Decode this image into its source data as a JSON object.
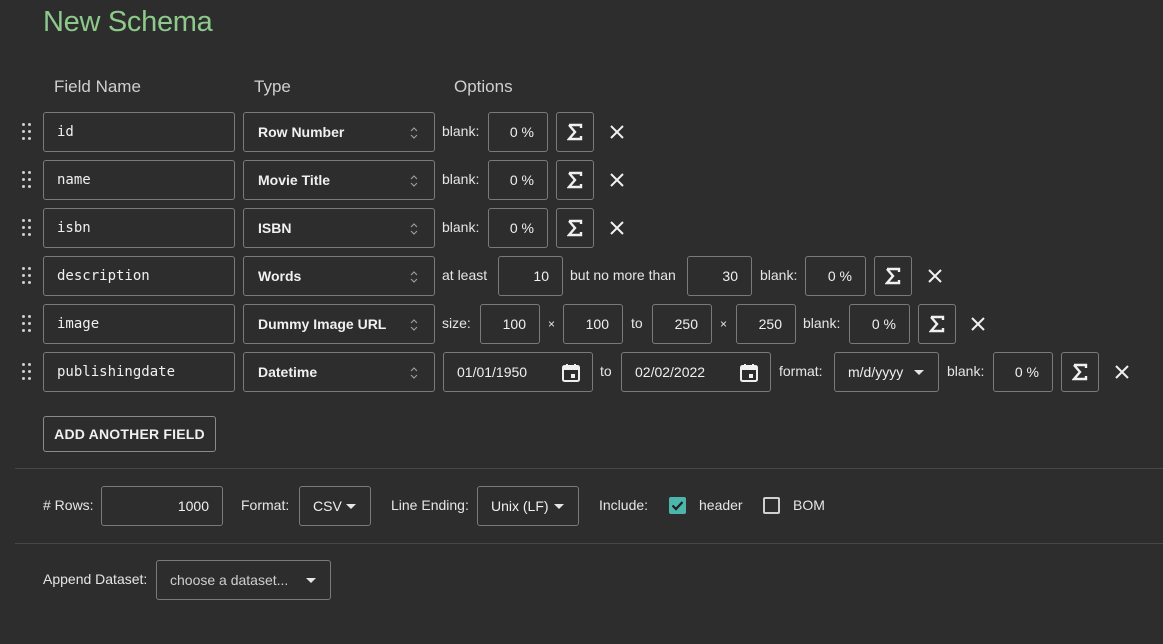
{
  "title": "New Schema",
  "columns": {
    "field_name": "Field Name",
    "type": "Type",
    "options": "Options"
  },
  "fields": [
    {
      "name": "id",
      "type": "Row Number",
      "blank_label": "blank:",
      "blank": "0 %"
    },
    {
      "name": "name",
      "type": "Movie Title",
      "blank_label": "blank:",
      "blank": "0 %"
    },
    {
      "name": "isbn",
      "type": "ISBN",
      "blank_label": "blank:",
      "blank": "0 %"
    },
    {
      "name": "description",
      "type": "Words",
      "atleast_label": "at least",
      "atleast": "10",
      "nomore_label": "but no more than",
      "nomore": "30",
      "blank_label": "blank:",
      "blank": "0 %"
    },
    {
      "name": "image",
      "type": "Dummy Image URL",
      "size_label": "size:",
      "w1": "100",
      "times": "×",
      "h1": "100",
      "to_label": "to",
      "w2": "250",
      "h2": "250",
      "blank_label": "blank:",
      "blank": "0 %"
    },
    {
      "name": "publishingdate",
      "type": "Datetime",
      "from": "01/01/1950",
      "to_label": "to",
      "to": "02/02/2022",
      "format_label": "format:",
      "format": "m/d/yyyy",
      "blank_label": "blank:",
      "blank": "0 %"
    }
  ],
  "add_field_label": "ADD ANOTHER FIELD",
  "options": {
    "rows_label": "# Rows:",
    "rows": "1000",
    "format_label": "Format:",
    "format": "CSV",
    "line_ending_label": "Line Ending:",
    "line_ending": "Unix (LF)",
    "include_label": "Include:",
    "header_label": "header",
    "header_checked": true,
    "bom_label": "BOM",
    "bom_checked": false
  },
  "append": {
    "label": "Append Dataset:",
    "placeholder": "choose a dataset..."
  },
  "colors": {
    "accent": "#8cc98a",
    "check": "#4db6ac",
    "background": "#2d2d2d"
  },
  "icons": [
    "drag-handle-icon",
    "updown-icon",
    "sigma-icon",
    "close-icon",
    "calendar-icon",
    "caret-down-icon",
    "checkbox-icon"
  ]
}
